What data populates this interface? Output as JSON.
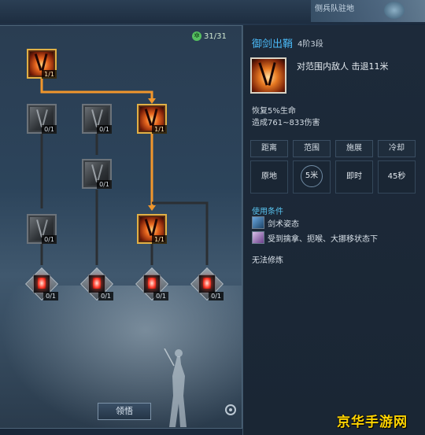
{
  "topbar": {
    "location_text": "侧兵队驻地"
  },
  "points": {
    "value": "31/31"
  },
  "tree_nodes": [
    {
      "id": "root",
      "state": "active",
      "count": "1/1"
    },
    {
      "id": "r2c1",
      "state": "grey",
      "count": "0/1"
    },
    {
      "id": "r2c2",
      "state": "grey",
      "count": "0/1"
    },
    {
      "id": "r2c3",
      "state": "active",
      "count": "1/1"
    },
    {
      "id": "r3c2",
      "state": "grey",
      "count": "0/1"
    },
    {
      "id": "r4c1",
      "state": "grey",
      "count": "0/1"
    },
    {
      "id": "r4c3",
      "state": "active",
      "count": "1/1"
    },
    {
      "id": "r5c1",
      "state": "locked",
      "count": "0/1"
    },
    {
      "id": "r5c2",
      "state": "locked",
      "count": "0/1"
    },
    {
      "id": "r5c3",
      "state": "locked",
      "count": "0/1"
    },
    {
      "id": "r5c4",
      "state": "locked",
      "count": "0/1"
    }
  ],
  "learn_button": {
    "label": "领悟"
  },
  "skill": {
    "name": "御剑出鞘",
    "level": "4阶3段",
    "description": "对范围内敌人 击退11米",
    "effects": [
      "恢复5%生命",
      "造成761~833伤害"
    ]
  },
  "stats": {
    "headers": [
      "距离",
      "范围",
      "施展",
      "冷却"
    ],
    "values": [
      "原地",
      "5米",
      "即时",
      "45秒"
    ]
  },
  "conditions": {
    "title": "使用条件",
    "items": [
      {
        "icon": "sword-stance-icon",
        "text": "剑术姿态"
      },
      {
        "icon": "restrained-status-icon",
        "text": "受到擒拿、扼喉、大挪移状态下"
      }
    ]
  },
  "cannot_train": "无法修炼",
  "watermark": "京华手游网",
  "colors": {
    "accent_orange": "#f0962c",
    "title_blue": "#4ab8f5",
    "condition_blue": "#58c2ee"
  }
}
